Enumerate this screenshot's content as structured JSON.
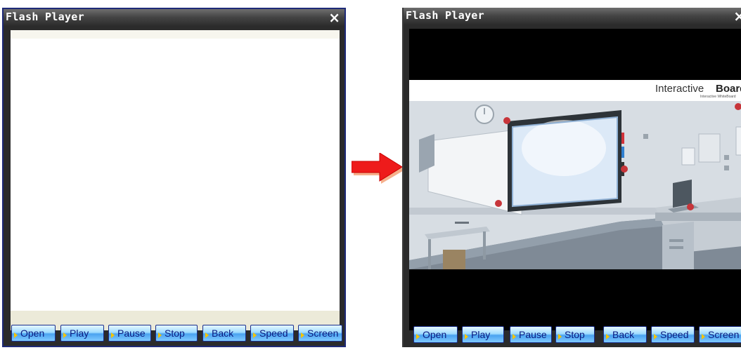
{
  "left_window": {
    "title": "Flash Player",
    "close_glyph": "×",
    "buttons": [
      "Open",
      "Play",
      "Pause",
      "Stop",
      "Back",
      "Speed",
      "Screen"
    ]
  },
  "right_window": {
    "title": "Flash Player",
    "close_glyph": "×",
    "buttons": [
      "Open",
      "Play",
      "Pause",
      "Stop",
      "Back",
      "Speed",
      "Screen"
    ],
    "video": {
      "title_main": "Interactive",
      "title_bold": "Board",
      "subtitle": "Interactive WhiteBoard"
    }
  },
  "colors": {
    "arrow_fill": "#ee1b1b",
    "arrow_shadow": "#f6b08c",
    "button_text": "#0a1a80",
    "accent": "#d2323a"
  },
  "icons": [
    "close-icon",
    "play-triangle-icon",
    "right-arrow-icon"
  ]
}
